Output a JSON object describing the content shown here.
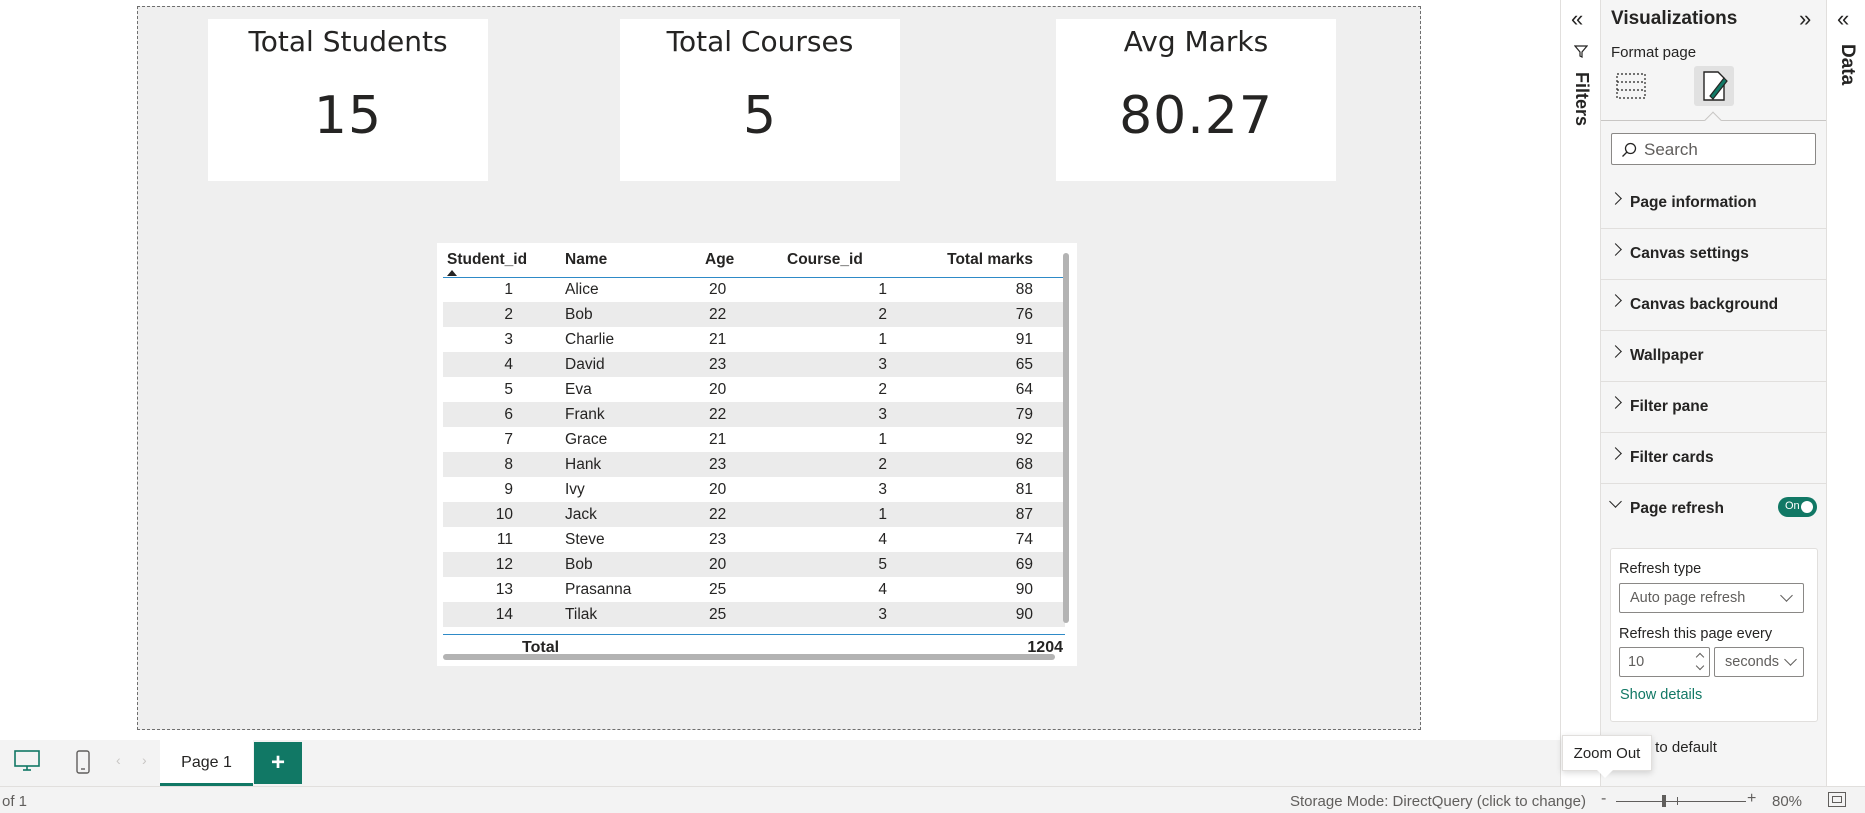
{
  "cards": [
    {
      "title": "Total Students",
      "value": "15"
    },
    {
      "title": "Total Courses",
      "value": "5"
    },
    {
      "title": "Avg Marks",
      "value": "80.27"
    }
  ],
  "table": {
    "columns": [
      "Student_id",
      "Name",
      "Age",
      "Course_id",
      "Total marks"
    ],
    "rows": [
      [
        "1",
        "Alice",
        "20",
        "1",
        "88"
      ],
      [
        "2",
        "Bob",
        "22",
        "2",
        "76"
      ],
      [
        "3",
        "Charlie",
        "21",
        "1",
        "91"
      ],
      [
        "4",
        "David",
        "23",
        "3",
        "65"
      ],
      [
        "5",
        "Eva",
        "20",
        "2",
        "64"
      ],
      [
        "6",
        "Frank",
        "22",
        "3",
        "79"
      ],
      [
        "7",
        "Grace",
        "21",
        "1",
        "92"
      ],
      [
        "8",
        "Hank",
        "23",
        "2",
        "68"
      ],
      [
        "9",
        "Ivy",
        "20",
        "3",
        "81"
      ],
      [
        "10",
        "Jack",
        "22",
        "1",
        "87"
      ],
      [
        "11",
        "Steve",
        "23",
        "4",
        "74"
      ],
      [
        "12",
        "Bob",
        "20",
        "5",
        "69"
      ],
      [
        "13",
        "Prasanna",
        "25",
        "4",
        "90"
      ],
      [
        "14",
        "Tilak",
        "25",
        "3",
        "90"
      ]
    ],
    "total_label": "Total",
    "total_value": "1204",
    "sort_icon": "sort-ascending-icon"
  },
  "page_bar": {
    "tab_label": "Page 1",
    "add_label": "+",
    "desktop_icon": "desktop-view-icon",
    "mobile_icon": "mobile-view-icon"
  },
  "status_bar": {
    "page_count": "of 1",
    "storage_mode": "Storage Mode: DirectQuery (click to change)",
    "zoom_minus": "-",
    "zoom_plus": "+",
    "zoom_level": "80%",
    "tooltip": "Zoom Out"
  },
  "filters_pane": {
    "label": "Filters",
    "collapse_glyph": "«"
  },
  "viz_pane": {
    "title": "Visualizations",
    "expand_glyph": "»",
    "format_label": "Format page",
    "search_placeholder": "Search",
    "sections": [
      "Page information",
      "Canvas settings",
      "Canvas background",
      "Wallpaper",
      "Filter pane",
      "Filter cards",
      "Page refresh"
    ],
    "toggle_label": "On",
    "refresh": {
      "type_label": "Refresh type",
      "type_value": "Auto page refresh",
      "every_label": "Refresh this page every",
      "interval_value": "10",
      "unit_value": "seconds",
      "show_details": "Show details"
    },
    "reset_label": "set to default",
    "accent_color": "#117865"
  },
  "data_pane": {
    "label": "Data",
    "collapse_glyph": "«"
  }
}
